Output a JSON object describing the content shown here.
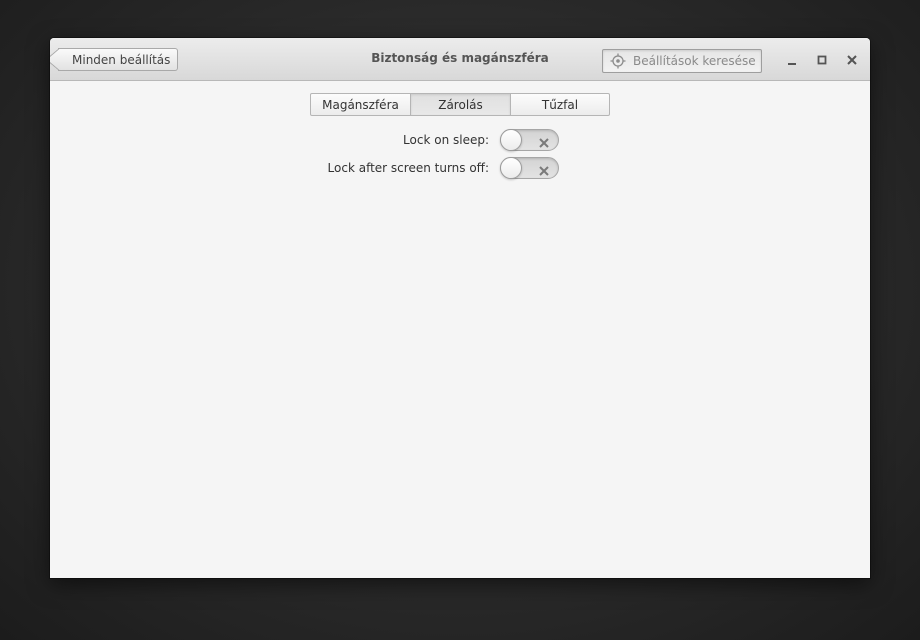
{
  "window": {
    "title": "Biztonság és magánszféra",
    "back_label": "Minden beállítás",
    "search": {
      "placeholder": "Beállítások keresése",
      "value": ""
    },
    "controls": {
      "minimize_icon": "minimize-icon",
      "maximize_icon": "maximize-icon",
      "close_icon": "close-icon"
    }
  },
  "tabs": [
    {
      "label": "Magánszféra",
      "active": false
    },
    {
      "label": "Zárolás",
      "active": true
    },
    {
      "label": "Tűzfal",
      "active": false
    }
  ],
  "settings": [
    {
      "label": "Lock on sleep:",
      "enabled": false
    },
    {
      "label": "Lock after screen turns off:",
      "enabled": false
    }
  ],
  "colors": {
    "window_bg": "#f5f5f5",
    "titlebar_top": "#ececec",
    "titlebar_bottom": "#d8d8d8",
    "desktop_bg": "#2a2a2a"
  }
}
